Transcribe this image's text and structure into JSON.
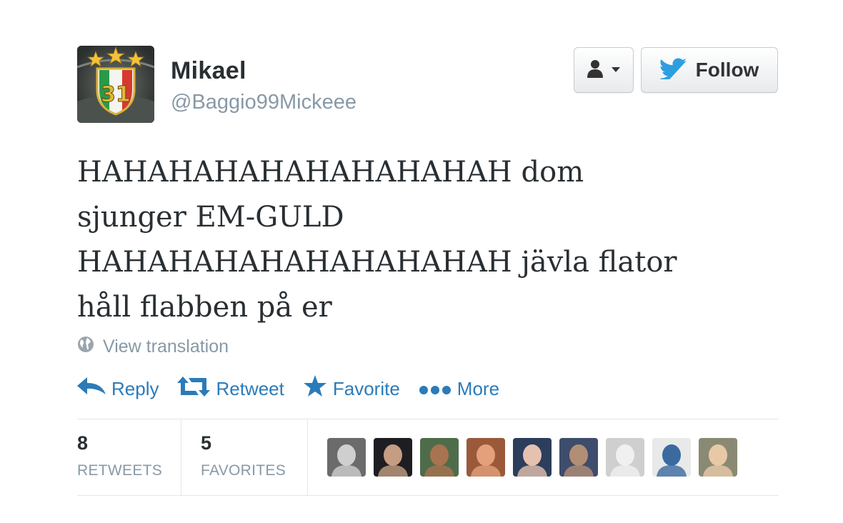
{
  "user": {
    "fullname": "Mikael",
    "screen_name": "@Baggio99Mickeee",
    "avatar_number": "31"
  },
  "buttons": {
    "follow_label": "Follow"
  },
  "tweet": {
    "lines": [
      "HAHAHAHAHAHAHAHAHAH dom",
      "sjunger EM-GULD",
      "HAHAHAHAHAHAHAHAHAH jävla flator",
      "håll flabben på er"
    ]
  },
  "translation": {
    "label": "View translation"
  },
  "actions": {
    "reply": "Reply",
    "retweet": "Retweet",
    "favorite": "Favorite",
    "more": "More"
  },
  "stats": {
    "retweets_count": "8",
    "retweets_label": "RETWEETS",
    "favorites_count": "5",
    "favorites_label": "FAVORITES"
  },
  "favoriters": [
    {
      "name": "favoriter-1",
      "bg": "#6b6b6b",
      "face": "#cfcfcf"
    },
    {
      "name": "favoriter-2",
      "bg": "#1e1e22",
      "face": "#c49d82"
    },
    {
      "name": "favoriter-3",
      "bg": "#4f6c4a",
      "face": "#a87350"
    },
    {
      "name": "favoriter-4",
      "bg": "#9a5a3a",
      "face": "#e3a07a"
    },
    {
      "name": "favoriter-5",
      "bg": "#2c3e5c",
      "face": "#e6c1b0"
    },
    {
      "name": "favoriter-6",
      "bg": "#3d4d6b",
      "face": "#b38e76"
    },
    {
      "name": "favoriter-7",
      "bg": "#cfcfcf",
      "face": "#f0f0f0"
    },
    {
      "name": "favoriter-8",
      "bg": "#e9e9e9",
      "face": "#3a6aa0"
    },
    {
      "name": "favoriter-9",
      "bg": "#8a8a74",
      "face": "#e7c9a7"
    }
  ],
  "colors": {
    "link": "#2b7bb9",
    "muted": "#8899a6",
    "twitter_blue": "#2d9ee0"
  }
}
